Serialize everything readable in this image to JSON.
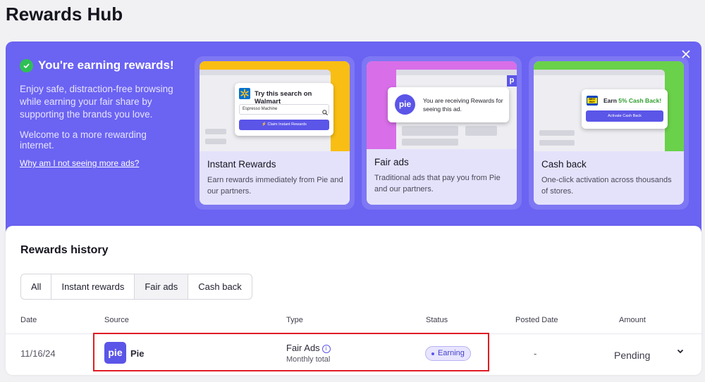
{
  "page": {
    "title": "Rewards Hub"
  },
  "hero": {
    "heading": "You're earning rewards!",
    "description": "Enjoy safe, distraction-free browsing while earning your fair share by supporting the brands you love.",
    "welcome": "Welcome to a more rewarding internet.",
    "link": "Why am I not seeing more ads?",
    "close_icon": "close-icon"
  },
  "cards": [
    {
      "title": "Instant Rewards",
      "description": "Earn rewards immediately from Pie and our partners.",
      "popup_title": "Try this search on Walmart",
      "popup_input": "Espresso Machine",
      "popup_button": "Claim Instant Rewards",
      "color": "#f9be13"
    },
    {
      "title": "Fair ads",
      "description": "Traditional ads that pay you from Pie and our partners.",
      "popup_text": "You are receiving Rewards for seeing this ad.",
      "logo_text": "pie",
      "corner_letter": "p",
      "color": "#d86ee8"
    },
    {
      "title": "Cash back",
      "description": "One-click activation across thousands of stores.",
      "popup_title_prefix": "Earn ",
      "popup_title_highlight": "5% Cash Back!",
      "popup_button": "Activate Cash Back",
      "brand_logo": "BEST BUY",
      "color": "#6ad14a"
    }
  ],
  "history": {
    "title": "Rewards history",
    "filters": [
      "All",
      "Instant rewards",
      "Fair ads",
      "Cash back"
    ],
    "active_filter": "Fair ads",
    "columns": [
      "Date",
      "Source",
      "Type",
      "Status",
      "Posted Date",
      "Amount"
    ],
    "rows": [
      {
        "date": "11/16/24",
        "source_logo": "pie",
        "source": "Pie",
        "type": "Fair Ads",
        "type_sub": "Monthly total",
        "status": "Earning",
        "posted_date": "-",
        "amount": "Pending"
      }
    ]
  },
  "colors": {
    "accent": "#6b63f2",
    "button": "#5b55e8",
    "highlight": "#e01b24",
    "success": "#2fbf55"
  }
}
